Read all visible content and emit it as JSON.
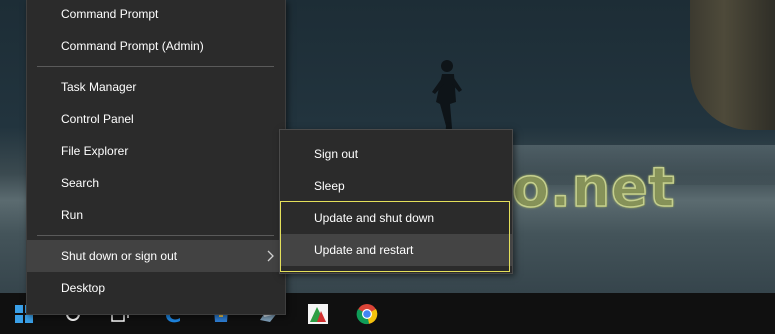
{
  "desktop": {
    "watermark_text": "o.net"
  },
  "winx_menu": {
    "items": [
      {
        "label": "Command Prompt"
      },
      {
        "label": "Command Prompt (Admin)"
      },
      {
        "label": "Task Manager"
      },
      {
        "label": "Control Panel"
      },
      {
        "label": "File Explorer"
      },
      {
        "label": "Search"
      },
      {
        "label": "Run"
      },
      {
        "label": "Shut down or sign out"
      },
      {
        "label": "Desktop"
      }
    ]
  },
  "submenu": {
    "items": [
      {
        "label": "Sign out"
      },
      {
        "label": "Sleep"
      },
      {
        "label": "Update and shut down"
      },
      {
        "label": "Update and restart"
      }
    ]
  },
  "taskbar": {
    "icons": [
      "start-icon",
      "cortana-icon",
      "task-view-icon",
      "edge-icon",
      "store-icon",
      "network-app-icon",
      "photo-app-icon",
      "chrome-icon"
    ]
  },
  "colors": {
    "menu_bg": "#2b2b2b",
    "menu_hover": "#424242",
    "highlight_box": "#e4e05a",
    "start_blue": "#3aa0e8"
  }
}
